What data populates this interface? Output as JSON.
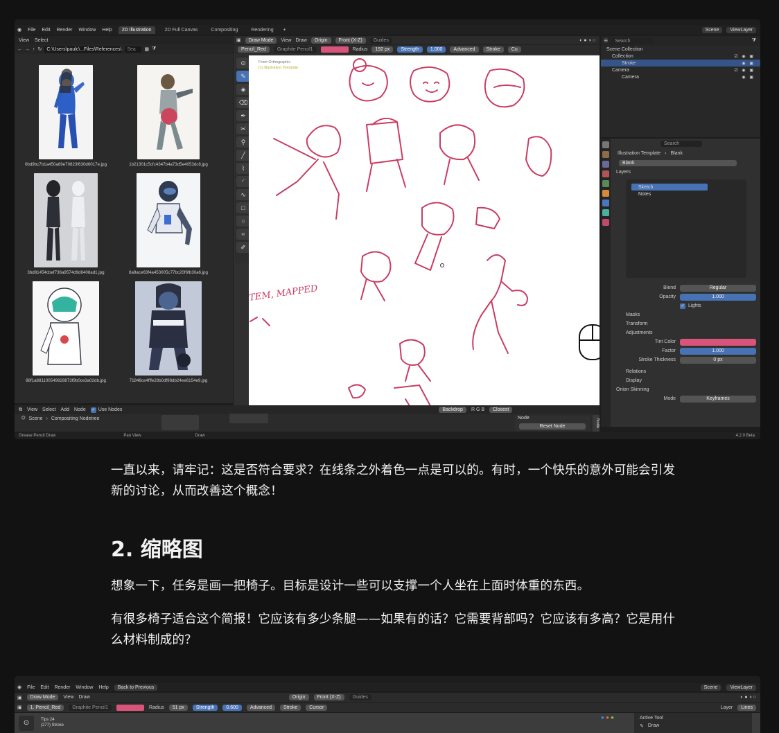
{
  "window1": {
    "menus": [
      "File",
      "Edit",
      "Render",
      "Window",
      "Help"
    ],
    "workspaces": [
      "2D Illustration",
      "2D Full Canvas",
      "Compositing",
      "Rendering"
    ],
    "scene": "Scene",
    "viewlayer": "ViewLayer",
    "filebrowser": {
      "menu": [
        "View",
        "Select"
      ],
      "path": "C:\\Users\\paulc\\...Files\\References\\",
      "search": "Sea",
      "files": [
        "0bd9bc7b1a450a89e70823f630d6017e.jpg",
        "1b21301c5cfc4347b4a73d5e4053dc8.jpg",
        "3bd81454cbef736a9574d9d8408ad1.jpg",
        "8a9ace63f4a453005c77bc20f6fb30a6.jpg",
        "88f1a881100549828873f9b0ce3a02db.jpg",
        "71848ce4fffe28b0df98db24ee6154e9.jpg"
      ]
    },
    "viewport": {
      "mode": "Draw Mode",
      "menu": [
        "View",
        "Draw"
      ],
      "origin": "Origin",
      "view": "Front (X-Z)",
      "guides": "Guides",
      "brush": "Pencil_Red",
      "material": "Graphite Pencil1",
      "radius_label": "Radius",
      "radius_value": "192 px",
      "strength_label": "Strength",
      "strength_value": "1.000",
      "advanced": "Advanced",
      "stroke": "Stroke",
      "cursor": "Cu",
      "title": "Front Orthographic",
      "subtitle": "(1) Illustration Template",
      "handwriting": "TEM, MAPPED"
    },
    "outliner": {
      "search": "Search",
      "rows": [
        "Scene Collection",
        "Collection",
        "Stroke",
        "Camera",
        "Camera"
      ]
    },
    "properties": {
      "search": "Search",
      "breadcrumb_object": "Illustration Template",
      "breadcrumb_data": "Blank",
      "data_name": "Blank",
      "layers_label": "Layers",
      "layers": [
        "Sketch",
        "Notes"
      ],
      "blend_label": "Blend",
      "blend_value": "Regular",
      "opacity_label": "Opacity",
      "opacity_value": "1.000",
      "lights_label": "Lights",
      "masks": "Masks",
      "transform": "Transform",
      "adjustments": "Adjustments",
      "tint_label": "Tint Color",
      "factor_label": "Factor",
      "factor_value": "1.000",
      "thickness_label": "Stroke Thickness",
      "thickness_value": "0 px",
      "relations": "Relations",
      "display": "Display",
      "onion": "Onion Skinning",
      "mode_label": "Mode",
      "mode_value": "Keyframes"
    },
    "nodeeditor": {
      "menu": [
        "View",
        "Select",
        "Add",
        "Node"
      ],
      "use_nodes": "Use Nodes",
      "scene": "Scene",
      "tree": "Compositing Nodetree",
      "backdrop": "Backdrop",
      "channels": "R G B",
      "closest": "Closest",
      "node_label": "Node",
      "reset": "Reset Node",
      "side_tab": "Node"
    },
    "status": [
      "Grease Pencil Draw",
      "Pan View",
      "Draw"
    ],
    "version": "4.2.0 Beta",
    "colors": {
      "brush": "#d9547a",
      "accent": "#4772b3",
      "stroke_line": "#c93d62"
    }
  },
  "article": {
    "para1": "一直以来，请牢记：这是否符合要求？在线条之外着色一点是可以的。有时，一个快乐的意外可能会引发新的讨论，从而改善这个概念！",
    "heading": "2. 缩略图",
    "para2": "想象一下，任务是画一把椅子。目标是设计一些可以支撑一个人坐在上面时体重的东西。",
    "para3": "有很多椅子适合这个简报！它应该有多少条腿——如果有的话？它需要背部吗？它应该有多高？它是用什么材料制成的？"
  },
  "window2": {
    "menus": [
      "File",
      "Edit",
      "Render",
      "Window",
      "Help"
    ],
    "back": "Back to Previous",
    "scene": "Scene",
    "viewlayer": "ViewLayer",
    "mode": "Draw Mode",
    "menu": [
      "View",
      "Draw"
    ],
    "origin": "Origin",
    "view": "Front (X-Z)",
    "guides": "Guides",
    "brush": "1. Pencil_Red",
    "material": "Graphite Pencil1",
    "radius_label": "Radius",
    "radius_value": "51 px",
    "strength_label": "Strength",
    "strength_value": "0.600",
    "advanced": "Advanced",
    "stroke": "Stroke",
    "cursor": "Cursor",
    "layer": "Layer",
    "lines": "Lines",
    "info1": "Tips 24",
    "info2": "(277) Stroke",
    "active_tool": "Active Tool",
    "draw": "Draw"
  }
}
